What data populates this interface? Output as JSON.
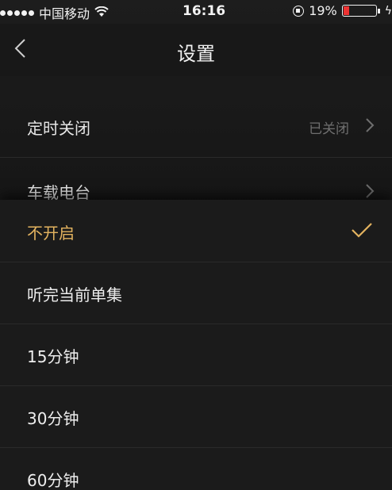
{
  "status_bar": {
    "carrier": "中国移动",
    "time": "16:16",
    "battery": "19%",
    "battery_level_fraction": 0.19,
    "signal_icon": "signal-dots-icon",
    "wifi_icon": "wifi-icon",
    "lock_icon": "orientation-lock-icon",
    "charging_icon": "lightning-icon"
  },
  "header": {
    "title": "设置",
    "back_icon": "chevron-left-icon"
  },
  "settings": {
    "timer_label": "定时关闭",
    "timer_value": "已关闭",
    "car_radio_label": "车载电台"
  },
  "timer_sheet": {
    "options": [
      {
        "label": "不开启",
        "selected": true
      },
      {
        "label": "听完当前单集",
        "selected": false
      },
      {
        "label": "15分钟",
        "selected": false
      },
      {
        "label": "30分钟",
        "selected": false
      },
      {
        "label": "60分钟",
        "selected": false
      }
    ],
    "check_icon": "checkmark-icon"
  },
  "colors": {
    "accent": "#e3b35f",
    "background": "#1a1a1a",
    "text": "#eeeeee",
    "muted": "#6f6f6f",
    "battery_low": "#ee3333"
  }
}
